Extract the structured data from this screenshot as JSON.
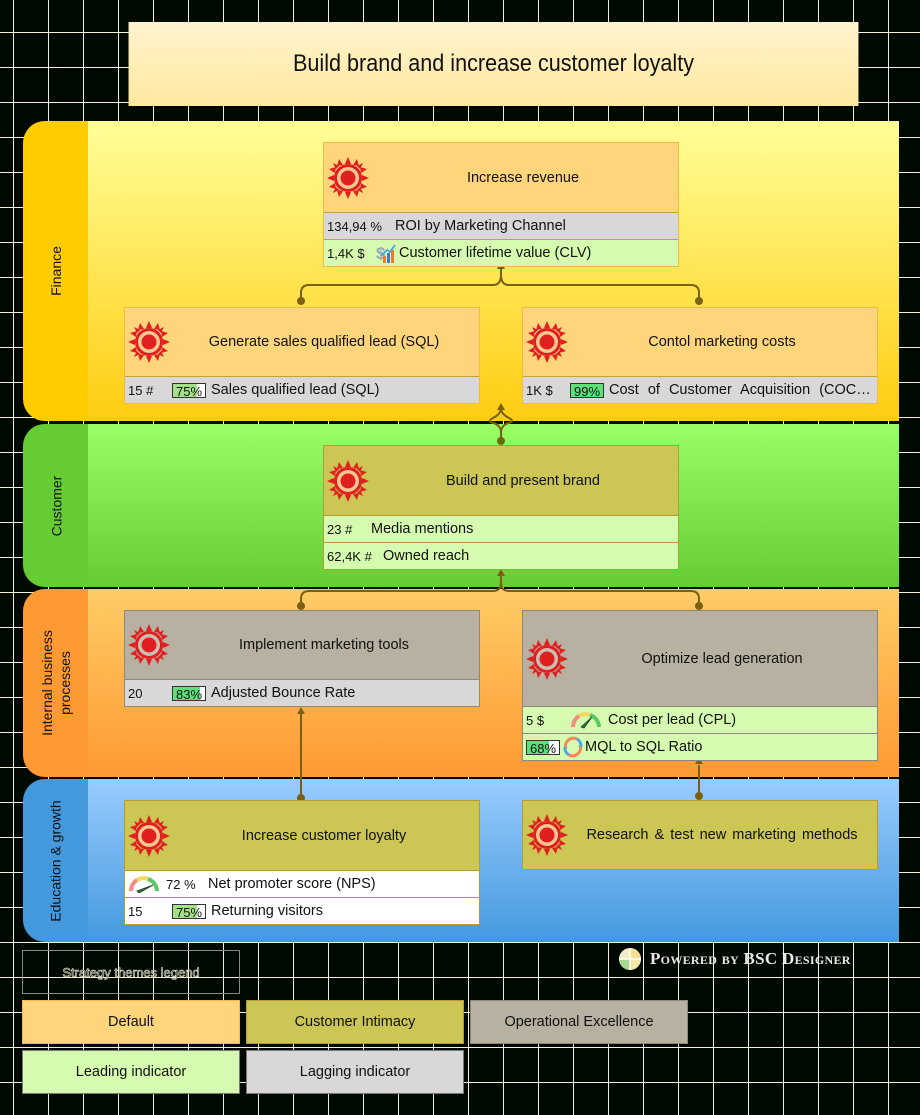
{
  "title": "Build brand and increase customer loyalty",
  "perspectives": [
    {
      "label": "Finance",
      "tab_color": "#ffcc00",
      "body_top": "#ffff99",
      "body_bottom": "#ffcc11"
    },
    {
      "label": "Customer",
      "tab_color": "#66cc33",
      "body_top": "#99ff66",
      "body_bottom": "#66cc33"
    },
    {
      "label": "Internal business processes",
      "label_line1": "Internal business",
      "label_line2": "processes",
      "tab_color": "#ff9933",
      "body_top": "#ffcc66",
      "body_bottom": "#ff9933"
    },
    {
      "label": "Education & growth",
      "tab_color": "#4499dd",
      "body_top": "#99ccff",
      "body_bottom": "#4499dd"
    }
  ],
  "objectives": {
    "increase_revenue": {
      "title": "Increase revenue",
      "theme": "Default",
      "indicators": [
        {
          "value": "134,94 %",
          "name": "ROI by Marketing Channel",
          "type": "lagging"
        },
        {
          "value": "1,4K $",
          "icon": "chart-growth-icon",
          "name": "Customer lifetime value (CLV)",
          "type": "leading"
        }
      ]
    },
    "generate_sql": {
      "title": "Generate sales qualified lead (SQL)",
      "theme": "Default",
      "indicators": [
        {
          "value": "15 #",
          "progress": 75,
          "progress_label": "75%",
          "name": "Sales qualified lead (SQL)",
          "type": "lagging"
        }
      ]
    },
    "control_costs": {
      "title": "Contol marketing costs",
      "theme": "Default",
      "indicators": [
        {
          "value": "1K $",
          "progress": 99,
          "progress_label": "99%",
          "name": "Cost of Customer Acquisition (COC…",
          "type": "lagging"
        }
      ]
    },
    "build_brand": {
      "title": "Build and present brand",
      "theme": "Customer Intimacy",
      "indicators": [
        {
          "value": "23 #",
          "name": "Media mentions",
          "type": "leading"
        },
        {
          "value": "62,4K #",
          "name": "Owned reach",
          "type": "leading"
        }
      ]
    },
    "marketing_tools": {
      "title": "Implement marketing tools",
      "theme": "Operational Excellence",
      "indicators": [
        {
          "value": "20",
          "progress": 83,
          "progress_label": "83%",
          "name": "Adjusted Bounce Rate",
          "type": "lagging"
        }
      ]
    },
    "lead_generation": {
      "title": "Optimize lead generation",
      "theme": "Operational Excellence",
      "indicators": [
        {
          "value": "5 $",
          "icon": "gauge-icon",
          "name": "Cost per lead (CPL)",
          "type": "leading"
        },
        {
          "progress": 68,
          "progress_label": "68%",
          "icon": "refresh-cycle-icon",
          "name": "MQL to SQL Ratio",
          "type": "leading"
        }
      ]
    },
    "customer_loyalty": {
      "title": "Increase customer loyalty",
      "theme": "Customer Intimacy",
      "indicators": [
        {
          "icon": "gauge-icon",
          "value": "72 %",
          "name": "Net promoter score (NPS)",
          "type": "white"
        },
        {
          "value": "15",
          "progress": 75,
          "progress_label": "75%",
          "name": "Returning visitors",
          "type": "white"
        }
      ]
    },
    "research": {
      "title": "Research & test new marketing methods",
      "theme": "Customer Intimacy",
      "indicators": []
    }
  },
  "powered_by": "Powered by BSC Designer",
  "legend": {
    "title": "Strategy themes legend",
    "themes": [
      {
        "label": "Default",
        "color": "#ffd57b"
      },
      {
        "label": "Customer Intimacy",
        "color": "#ccc654"
      },
      {
        "label": "Operational Excellence",
        "color": "#b8b1a2"
      }
    ],
    "indicators": [
      {
        "label": "Leading indicator",
        "color": "#d6fbb0"
      },
      {
        "label": "Lagging indicator",
        "color": "#d8d8d8"
      }
    ]
  },
  "colors": {
    "connector": "#7a6010",
    "sun_outer": "#e02020",
    "sun_ring": "#f4c890"
  }
}
